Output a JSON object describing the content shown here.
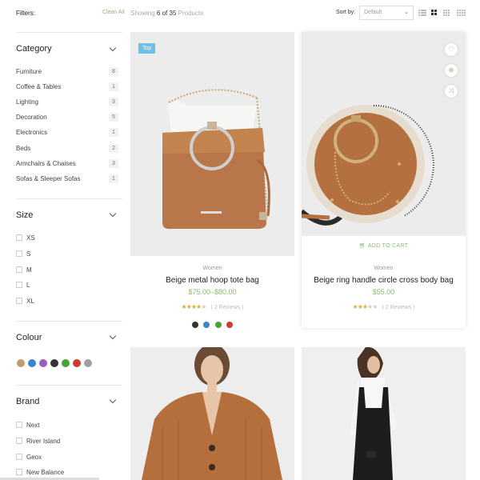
{
  "toolbar": {
    "filters_label": "Filters:",
    "clean_all": "Clean All",
    "showing_prefix": "Showing",
    "showing_range": "6 of 35",
    "showing_suffix": "Products",
    "sort_label": "Sort by:",
    "sort_value": "Default"
  },
  "sidebar": {
    "category": {
      "title": "Category",
      "items": [
        {
          "label": "Furniture",
          "count": "8"
        },
        {
          "label": "Coffee & Tables",
          "count": "1"
        },
        {
          "label": "Lighting",
          "count": "3"
        },
        {
          "label": "Decoration",
          "count": "5"
        },
        {
          "label": "Electronics",
          "count": "1"
        },
        {
          "label": "Beds",
          "count": "2"
        },
        {
          "label": "Armchairs & Chaises",
          "count": "3"
        },
        {
          "label": "Sofas & Sleeper Sofas",
          "count": "1"
        }
      ]
    },
    "size": {
      "title": "Size",
      "items": [
        "XS",
        "S",
        "M",
        "L",
        "XL"
      ]
    },
    "colour": {
      "title": "Colour",
      "swatches": [
        "#c49a6c",
        "#3a86c8",
        "#9b5fc0",
        "#333333",
        "#4aa33a",
        "#d13a32",
        "#a0a0a0"
      ]
    },
    "brand": {
      "title": "Brand",
      "items": [
        "Next",
        "River Island",
        "Geox",
        "New Balance"
      ]
    }
  },
  "products": [
    {
      "badge": "Top",
      "category": "Women",
      "title": "Beige metal hoop tote bag",
      "price": "$75.00–$80.00",
      "rating": 4,
      "reviews": "( 2 Reviews )",
      "colors": [
        "#333333",
        "#3a86c8",
        "#4aa33a",
        "#d13a32"
      ]
    },
    {
      "category": "Women",
      "title": "Beige ring handle circle cross body bag",
      "price": "$55.00",
      "rating": 3,
      "reviews": "( 2 Reviews )",
      "add_to_cart": "ADD TO CART"
    }
  ],
  "icons": {
    "wishlist": "heart-icon",
    "compare": "compare-icon",
    "quickview": "shuffle-icon",
    "cart": "cart-icon"
  },
  "colors": {
    "accent": "#8bb870",
    "badge": "#6cc1e8",
    "star": "#e3a846"
  }
}
